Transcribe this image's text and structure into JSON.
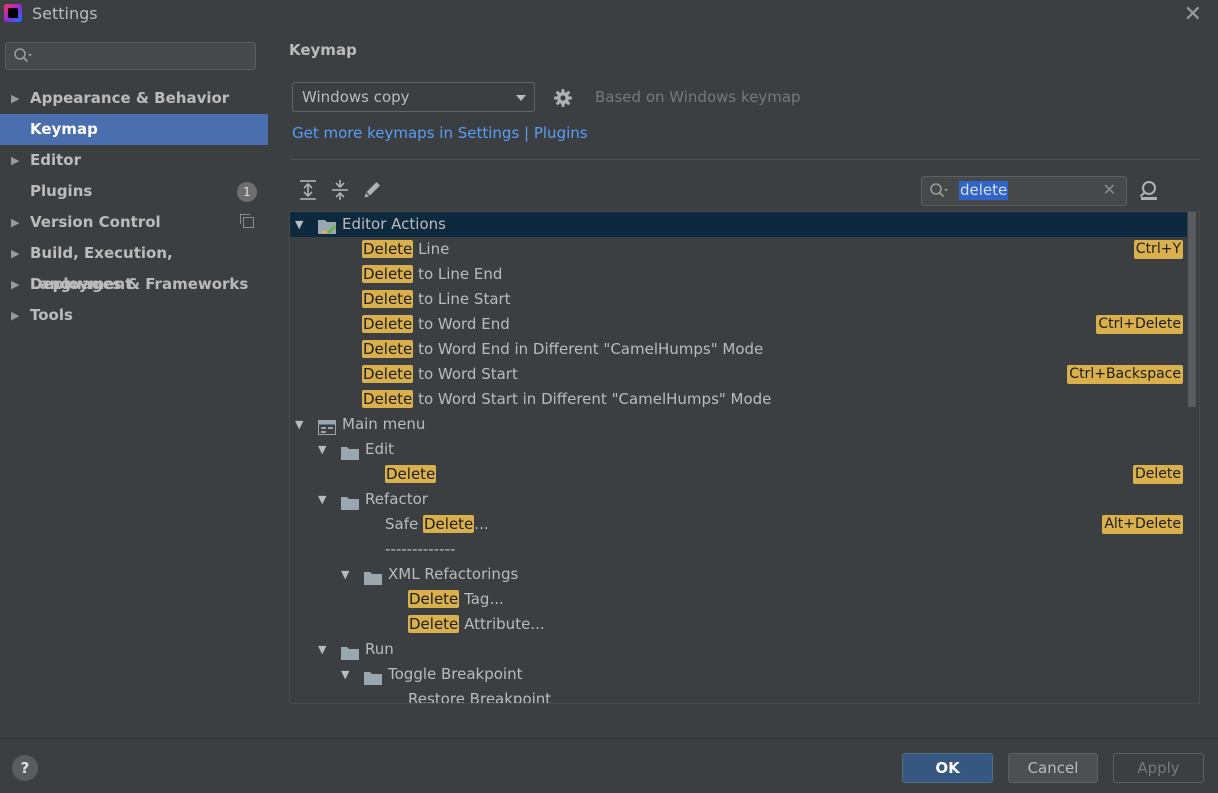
{
  "window": {
    "title": "Settings"
  },
  "sidebar": {
    "items": [
      {
        "label": "Appearance & Behavior",
        "expandable": true
      },
      {
        "label": "Keymap",
        "selected": true
      },
      {
        "label": "Editor",
        "expandable": true
      },
      {
        "label": "Plugins",
        "badge": "1"
      },
      {
        "label": "Version Control",
        "expandable": true,
        "icon": "copy-icon"
      },
      {
        "label": "Build, Execution, Deployment",
        "expandable": true
      },
      {
        "label": "Languages & Frameworks",
        "expandable": true
      },
      {
        "label": "Tools",
        "expandable": true
      }
    ]
  },
  "main": {
    "title": "Keymap",
    "keymap_combo": {
      "value": "Windows copy"
    },
    "based_on": "Based on Windows keymap",
    "link": "Get more keymaps in Settings | Plugins",
    "search": {
      "value": "delete"
    },
    "tree": [
      {
        "level": 0,
        "toggle": true,
        "icon": "editor-actions-icon",
        "selected": true,
        "segments": [
          {
            "t": "Editor Actions"
          }
        ]
      },
      {
        "level": 1,
        "segments": [
          {
            "t": "Delete",
            "hl": true
          },
          {
            "t": " Line"
          }
        ],
        "shortcut": "Ctrl+Y"
      },
      {
        "level": 1,
        "segments": [
          {
            "t": "Delete",
            "hl": true
          },
          {
            "t": " to Line End"
          }
        ]
      },
      {
        "level": 1,
        "segments": [
          {
            "t": "Delete",
            "hl": true
          },
          {
            "t": " to Line Start"
          }
        ]
      },
      {
        "level": 1,
        "segments": [
          {
            "t": "Delete",
            "hl": true
          },
          {
            "t": " to Word End"
          }
        ],
        "shortcut": "Ctrl+Delete"
      },
      {
        "level": 1,
        "segments": [
          {
            "t": "Delete",
            "hl": true
          },
          {
            "t": " to Word End in Different \"CamelHumps\" Mode"
          }
        ]
      },
      {
        "level": 1,
        "segments": [
          {
            "t": "Delete",
            "hl": true
          },
          {
            "t": " to Word Start"
          }
        ],
        "shortcut": "Ctrl+Backspace"
      },
      {
        "level": 1,
        "segments": [
          {
            "t": "Delete",
            "hl": true
          },
          {
            "t": " to Word Start in Different \"CamelHumps\" Mode"
          }
        ]
      },
      {
        "level": 0,
        "toggle": true,
        "icon": "main-menu-icon",
        "segments": [
          {
            "t": "Main menu"
          }
        ]
      },
      {
        "level": 1,
        "toggle": true,
        "icon": "folder-icon",
        "segments": [
          {
            "t": "Edit"
          }
        ]
      },
      {
        "level": 2,
        "segments": [
          {
            "t": "Delete",
            "hl": true
          }
        ],
        "shortcut": "Delete"
      },
      {
        "level": 1,
        "toggle": true,
        "icon": "folder-icon",
        "segments": [
          {
            "t": "Refactor"
          }
        ]
      },
      {
        "level": 2,
        "segments": [
          {
            "t": "Safe "
          },
          {
            "t": "Delete",
            "hl": true
          },
          {
            "t": "..."
          }
        ],
        "shortcut": "Alt+Delete"
      },
      {
        "level": 2,
        "segments": [
          {
            "t": "-------------"
          }
        ]
      },
      {
        "level": 2,
        "toggle": true,
        "icon": "folder-icon",
        "segments": [
          {
            "t": "XML Refactorings"
          }
        ]
      },
      {
        "level": 3,
        "segments": [
          {
            "t": "Delete",
            "hl": true
          },
          {
            "t": " Tag..."
          }
        ]
      },
      {
        "level": 3,
        "segments": [
          {
            "t": "Delete",
            "hl": true
          },
          {
            "t": " Attribute..."
          }
        ]
      },
      {
        "level": 1,
        "toggle": true,
        "icon": "folder-icon",
        "segments": [
          {
            "t": "Run"
          }
        ]
      },
      {
        "level": 2,
        "toggle": true,
        "icon": "folder-icon",
        "segments": [
          {
            "t": "Toggle Breakpoint"
          }
        ]
      },
      {
        "level": 3,
        "segments": [
          {
            "t": "Restore Breakpoint"
          }
        ]
      }
    ]
  },
  "footer": {
    "help": "?",
    "ok": "OK",
    "cancel": "Cancel",
    "apply": "Apply"
  },
  "colors": {
    "background": "#3c3f41",
    "selection": "#4b6eaf",
    "tree_selection": "#0d293e",
    "highlight": "#d9b04b",
    "link": "#589df6",
    "ok_button": "#365880"
  }
}
